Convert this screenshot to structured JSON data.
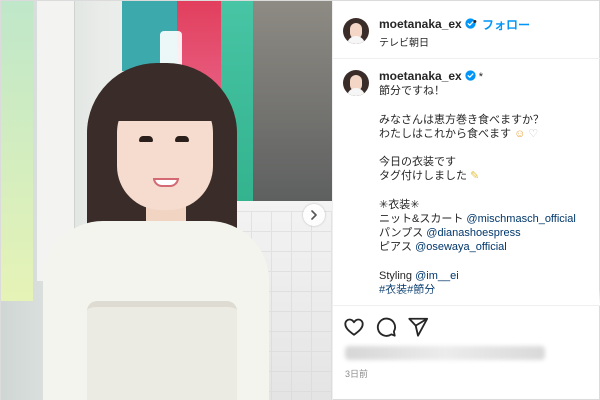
{
  "header": {
    "username": "moetanaka_ex",
    "separator": "•",
    "follow_label": "フォロー",
    "subtitle": "テレビ朝日"
  },
  "caption": {
    "username": "moetanaka_ex",
    "star": "*",
    "lines": {
      "l1": "節分ですね！",
      "l3": "みなさんは恵方巻き食べますか？",
      "l4": "わたしはこれから食べます",
      "l6": "今日の衣装です",
      "l7": "タグ付けしました",
      "l9": "✳衣装✳",
      "l10_text": "ニット&スカート ",
      "l10_mention": "@mischmasch_official",
      "l11_text": "パンプス ",
      "l11_mention": "@dianashoespress",
      "l12_text": "ピアス ",
      "l12_mention": "@osewaya_official",
      "l14_text": "Styling ",
      "l14_mention": "@im__ei",
      "l15": "#衣装#節分"
    },
    "emoji": {
      "smile": "☺",
      "heart": "♡",
      "tag": "✎"
    }
  },
  "footer": {
    "time": "3日前"
  },
  "icons": {
    "verified": "verified-badge-icon",
    "like": "heart-icon",
    "comment": "comment-icon",
    "share": "paper-plane-icon",
    "next": "chevron-right-icon"
  },
  "colors": {
    "link": "#00376b",
    "follow": "#0095f6",
    "verified": "#0095f6"
  }
}
